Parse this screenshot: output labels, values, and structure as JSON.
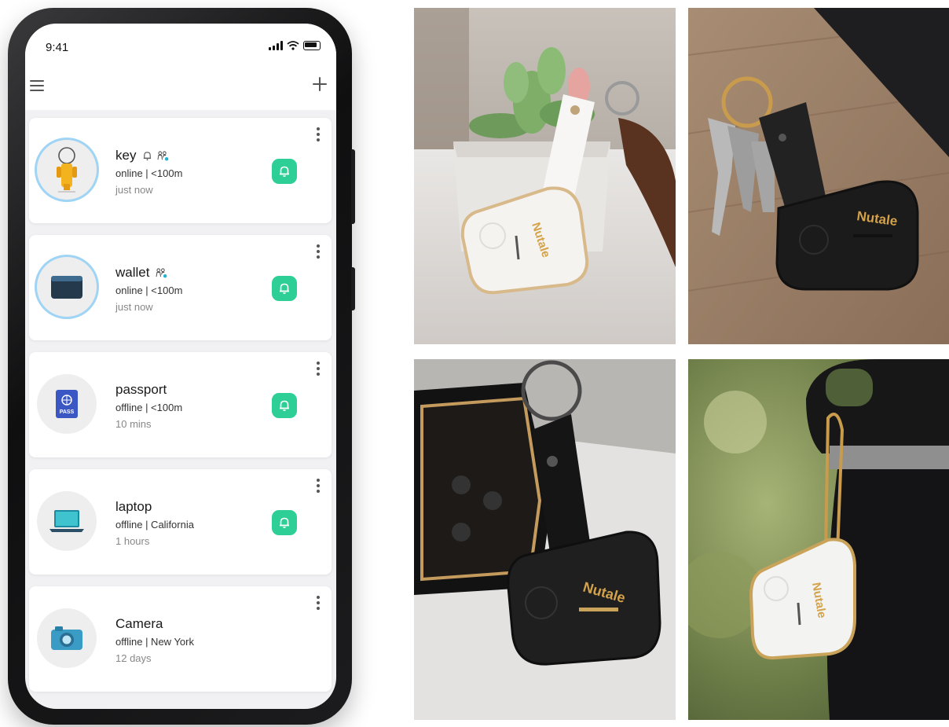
{
  "status_bar": {
    "time": "9:41"
  },
  "devices": [
    {
      "name": "key",
      "status": "online | <100m",
      "time": "just now",
      "icon": "key-icon",
      "shared": true,
      "alert": true
    },
    {
      "name": "wallet",
      "status": "online | <100m",
      "time": "just now",
      "icon": "wallet-icon",
      "shared": true,
      "alert": false
    },
    {
      "name": "passport",
      "status": "offline | <100m",
      "time": "10 mins",
      "icon": "passport-icon",
      "shared": false,
      "alert": false
    },
    {
      "name": "laptop",
      "status": "offline | California",
      "time": "1 hours",
      "icon": "laptop-icon",
      "shared": false,
      "alert": false
    },
    {
      "name": "Camera",
      "status": "offline | New York",
      "time": "12 days",
      "icon": "camera-icon",
      "shared": false,
      "alert": false
    }
  ],
  "passport_icon_text": "PASS",
  "brand": {
    "logo_text": "Nutale"
  },
  "colors": {
    "ring_button": "#2ecf96",
    "avatar_ring": "#9fd4f5",
    "screen_bg": "#f1f1f3",
    "brand_gold": "#d4a24a"
  }
}
